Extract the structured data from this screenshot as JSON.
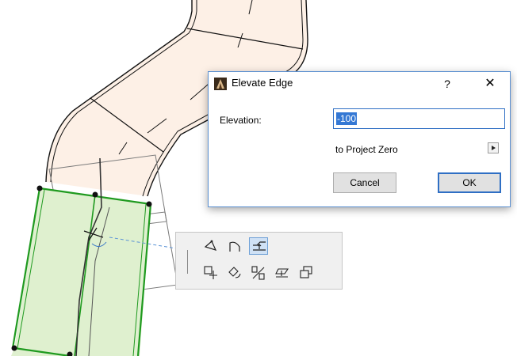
{
  "dialog": {
    "title": "Elevate Edge",
    "help": "?",
    "close": "✕",
    "elevation_label": "Elevation:",
    "elevation_value": "-100",
    "reference": "to Project Zero",
    "cancel": "Cancel",
    "ok": "OK"
  },
  "palette": {
    "tools": [
      "insert-node-icon",
      "curve-edge-icon",
      "elevate-edge-icon",
      "move-icon",
      "rotate-icon",
      "mirror-icon",
      "elevate-icon",
      "multiply-icon"
    ],
    "active_tool": "elevate-edge-icon"
  },
  "colors": {
    "slab_fill": "#fdf0e6",
    "selected_fill": "#dff0cf",
    "selection_green": "#1f9a1f",
    "dialog_accent": "#2f6fc4"
  }
}
